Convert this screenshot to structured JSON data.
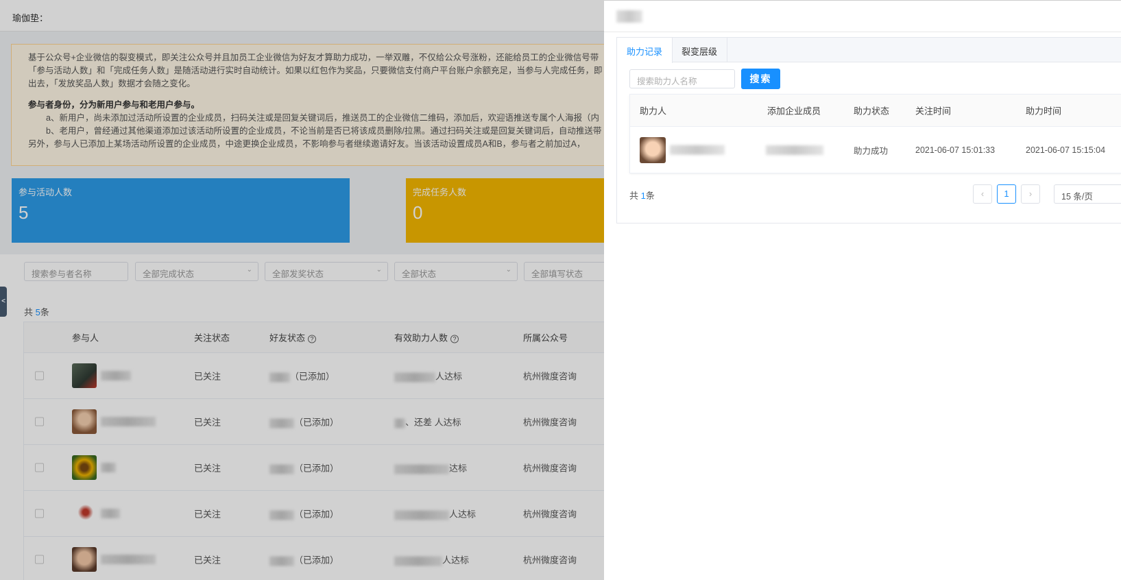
{
  "page": {
    "header_label": "瑜伽垫：",
    "notice": {
      "line1": "基于公众号+企业微信的裂变模式，即关注公众号并且加员工企业微信为好友才算助力成功，一举双雕，不仅给公众号涨粉，还能给员工的企业微信号带",
      "line2": "「参与活动人数」和「完成任务人数」是随活动进行实时自动统计。如果以红包作为奖品，只要微信支付商户平台账户余额充足，当参与人完成任务，即",
      "line3": "出去，「发放奖品人数」数据才会随之变化。",
      "heading": "参与者身份，分为新用户参与和老用户参与。",
      "item_a": "a、新用户，尚未添加过活动所设置的企业成员，扫码关注或是回复关键词后，推送员工的企业微信二维码，添加后，欢迎语推送专属个人海报（内",
      "item_b": "b、老用户，曾经通过其他渠道添加过该活动所设置的企业成员，不论当前是否已将该成员删除/拉黑。通过扫码关注或是回复关键词后，自动推送带",
      "line_last": "另外，参与人已添加上某场活动所设置的企业成员，中途更换企业成员，不影响参与者继续邀请好友。当该活动设置成员A和B，参与者之前加过A，"
    },
    "stats": [
      {
        "label": "参与活动人数",
        "value": "5",
        "color": "#2d9ce8"
      },
      {
        "label": "完成任务人数",
        "value": "0",
        "color": "#f5b800"
      }
    ],
    "filters": {
      "search_placeholder": "搜索参与者名称",
      "complete_status": "全部完成状态",
      "reward_status": "全部发奖状态",
      "status": "全部状态",
      "fill_status": "全部填写状态"
    },
    "total_prefix": "共 ",
    "total_count": "5",
    "total_suffix": "条",
    "table": {
      "headers": [
        "参与人",
        "关注状态",
        "好友状态",
        "有效助力人数",
        "所属公众号"
      ],
      "rows": [
        {
          "follow": "已关注",
          "friend": "（已添加）",
          "assist": "人达标",
          "account": "杭州微度咨询"
        },
        {
          "follow": "已关注",
          "friend": "（已添加）",
          "assist": "、还差 人达标",
          "account": "杭州微度咨询"
        },
        {
          "follow": "已关注",
          "friend": "（已添加）",
          "assist": "达标",
          "account": "杭州微度咨询"
        },
        {
          "follow": "已关注",
          "friend": "（已添加）",
          "assist": "人达标",
          "account": "杭州微度咨询"
        },
        {
          "follow": "已关注",
          "friend": "（已添加）",
          "assist": "人达标",
          "account": "杭州微度咨询"
        }
      ]
    }
  },
  "drawer": {
    "tabs": [
      {
        "label": "助力记录",
        "active": true
      },
      {
        "label": "裂变层级",
        "active": false
      }
    ],
    "search_placeholder": "搜索助力人名称",
    "search_button": "搜索",
    "table": {
      "headers": [
        "助力人",
        "添加企业成员",
        "助力状态",
        "关注时间",
        "助力时间"
      ],
      "rows": [
        {
          "status": "助力成功",
          "follow_time": "2021-06-07 15:01:33",
          "assist_time": "2021-06-07 15:15:04"
        }
      ]
    },
    "total_prefix": "共 ",
    "total_count": "1",
    "total_suffix": "条",
    "pagination": {
      "prev_icon": "chevron-left-icon",
      "current_page": "1",
      "next_icon": "chevron-right-icon",
      "page_size": "15 条/页"
    }
  }
}
